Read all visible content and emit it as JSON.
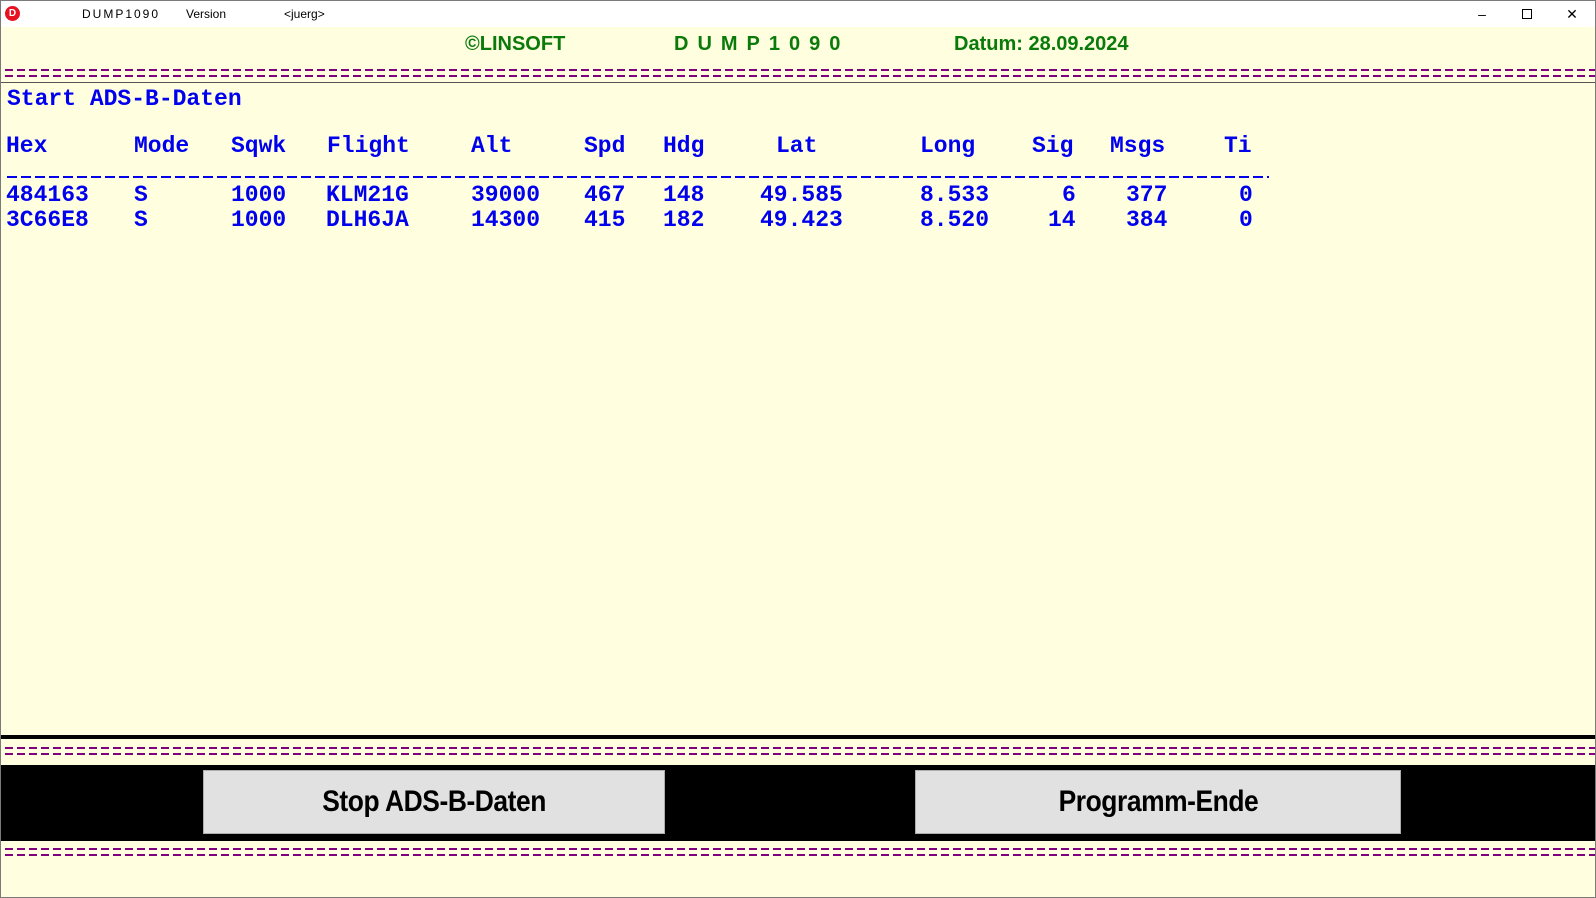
{
  "titlebar": {
    "app_icon": "D",
    "title": "DUMP1090",
    "version": "Version",
    "user": "<juerg>",
    "min_label": "–",
    "close_label": "✕"
  },
  "header": {
    "linsoft": "©LINSOFT",
    "app_name": "DUMP1090",
    "date": "Datum: 28.09.2024"
  },
  "data": {
    "start_line": "Start ADS-B-Daten",
    "columns": [
      "Hex",
      "Mode",
      "Sqwk",
      "Flight",
      "Alt",
      "Spd",
      "Hdg",
      "Lat",
      "Long",
      "Sig",
      "Msgs",
      "Ti"
    ],
    "rows": [
      [
        "484163",
        "S",
        "1000",
        "KLM21G",
        "39000",
        "467",
        "148",
        "49.585",
        "8.533",
        "6",
        "377",
        "0"
      ],
      [
        "3C66E8",
        "S",
        "1000",
        "DLH6JA",
        "14300",
        "415",
        "182",
        "49.423",
        "8.520",
        "14",
        "384",
        "0"
      ]
    ]
  },
  "buttons": {
    "stop": "Stop ADS-B-Daten",
    "end": "Programm-Ende"
  },
  "colors": {
    "background": "#ffffe0",
    "header_text": "#0a7a0a",
    "data_text": "#0000ee",
    "dash_line": "#800080"
  }
}
